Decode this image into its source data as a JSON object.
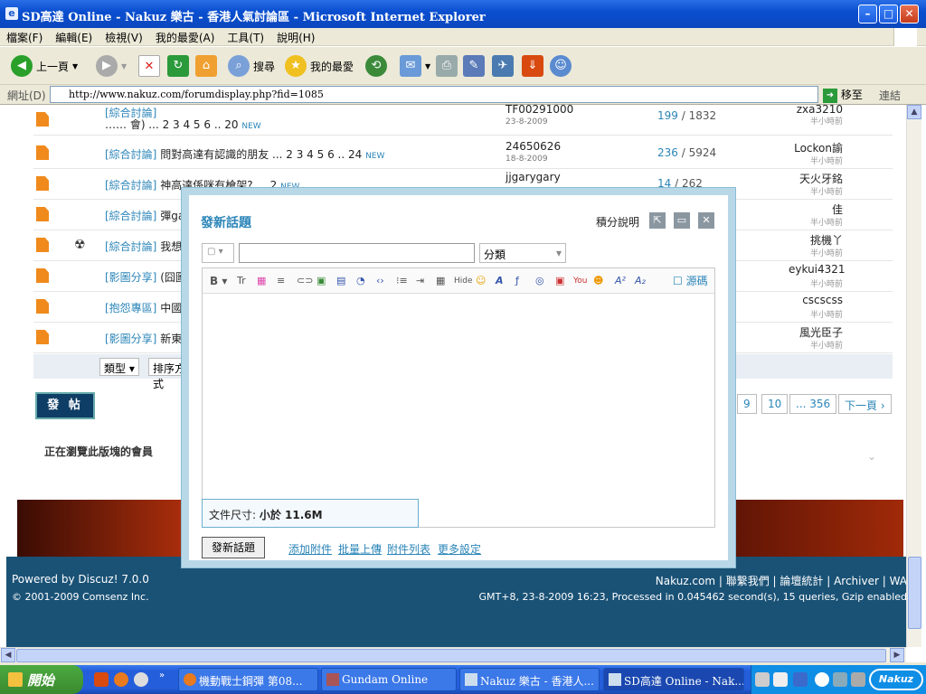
{
  "window": {
    "title": "SD高達 Online - Nakuz 樂古 - 香港人氣討論區 - Microsoft Internet Explorer"
  },
  "menu": [
    "檔案(F)",
    "編輯(E)",
    "檢視(V)",
    "我的最愛(A)",
    "工具(T)",
    "說明(H)"
  ],
  "toolbar": {
    "back": "上一頁",
    "search": "搜尋",
    "favorites": "我的最愛"
  },
  "address": {
    "label": "網址(D)",
    "url": "http://www.nakuz.com/forumdisplay.php?fid=1085",
    "go": "移至",
    "links": "連結"
  },
  "threads": [
    {
      "cat": "[綜合討論]",
      "subj": "…… 會) ... 2 3 4 5 6 .. 20",
      "new": "NEW",
      "author": "TF00291000",
      "date": "23-8-2009",
      "replies": "199",
      "views": "1832",
      "last": "zxa3210",
      "last_time": "半小時前"
    },
    {
      "cat": "[綜合討論]",
      "subj": "問對高達有認識的朋友 ... 2 3 4 5 6 .. 24",
      "new": "NEW",
      "author": "24650626",
      "date": "18-8-2009",
      "replies": "236",
      "views": "5924",
      "last": "Lockon諭",
      "last_time": "半小時前"
    },
    {
      "cat": "[綜合討論]",
      "subj": "神高達係咪有槍架? ... 2",
      "new": "NEW",
      "author": "jjgarygary",
      "date": "",
      "replies": "14",
      "views": "262",
      "last": "天火牙銘",
      "last_time": "半小時前"
    },
    {
      "cat": "[綜合討論]",
      "subj": "彈gar",
      "new": "",
      "author": "",
      "date": "",
      "replies": "",
      "views": "",
      "last": "佳",
      "last_time": "半小時前"
    },
    {
      "cat": "[綜合討論]",
      "subj": "我想",
      "new": "",
      "author": "",
      "date": "",
      "replies": "",
      "views": "",
      "last": "挑機丫",
      "last_time": "半小時前"
    },
    {
      "cat": "[影圖分享]",
      "subj": "(囧圖",
      "new": "",
      "author": "",
      "date": "",
      "replies": "",
      "views": "",
      "last": "eykui4321",
      "last_time": "半小時前"
    },
    {
      "cat": "[抱怨專區]",
      "subj": "中國人",
      "new": "",
      "author": "",
      "date": "",
      "replies": "",
      "views": "",
      "last": "cscscss",
      "last_time": "半小時前"
    },
    {
      "cat": "[影圖分享]",
      "subj": "新東京",
      "new": "",
      "author": "",
      "date": "",
      "replies": "",
      "views": "",
      "last": "風光臣子",
      "last_time": "半小時前"
    }
  ],
  "filter": {
    "type": "類型",
    "order": "排序方式"
  },
  "post_button": "發 帖",
  "pager": {
    "p9": "9",
    "p10": "10",
    "last": "... 356",
    "next": "下一頁"
  },
  "browsing": "正在瀏覽此版塊的會員",
  "footer": {
    "powered": "Powered by Discuz! 7.0.0",
    "copy": "© 2001-2009 Comsenz Inc.",
    "links": "Nakuz.com | 聯繫我們 | 論壇統計 | Archiver | WA",
    "info": "GMT+8, 23-8-2009 16:23, Processed in 0.045462 second(s), 15 queries, Gzip enabled"
  },
  "modal": {
    "title": "發新話題",
    "help": "積分說明",
    "category": "分類",
    "source": "源碼",
    "file_size_label": "文件尺寸:",
    "file_size_value": "小於 11.6M",
    "submit": "發新話題",
    "links": [
      "添加附件",
      "批量上傳",
      "附件列表",
      "更多設定"
    ]
  },
  "taskbar": {
    "start": "開始",
    "tasks": [
      "機動戰士鋼彈 第08...",
      "Gundam Online",
      "Nakuz 樂古 - 香港人...",
      "SD高達 Online - Nak..."
    ],
    "clock": "Nakuz"
  }
}
